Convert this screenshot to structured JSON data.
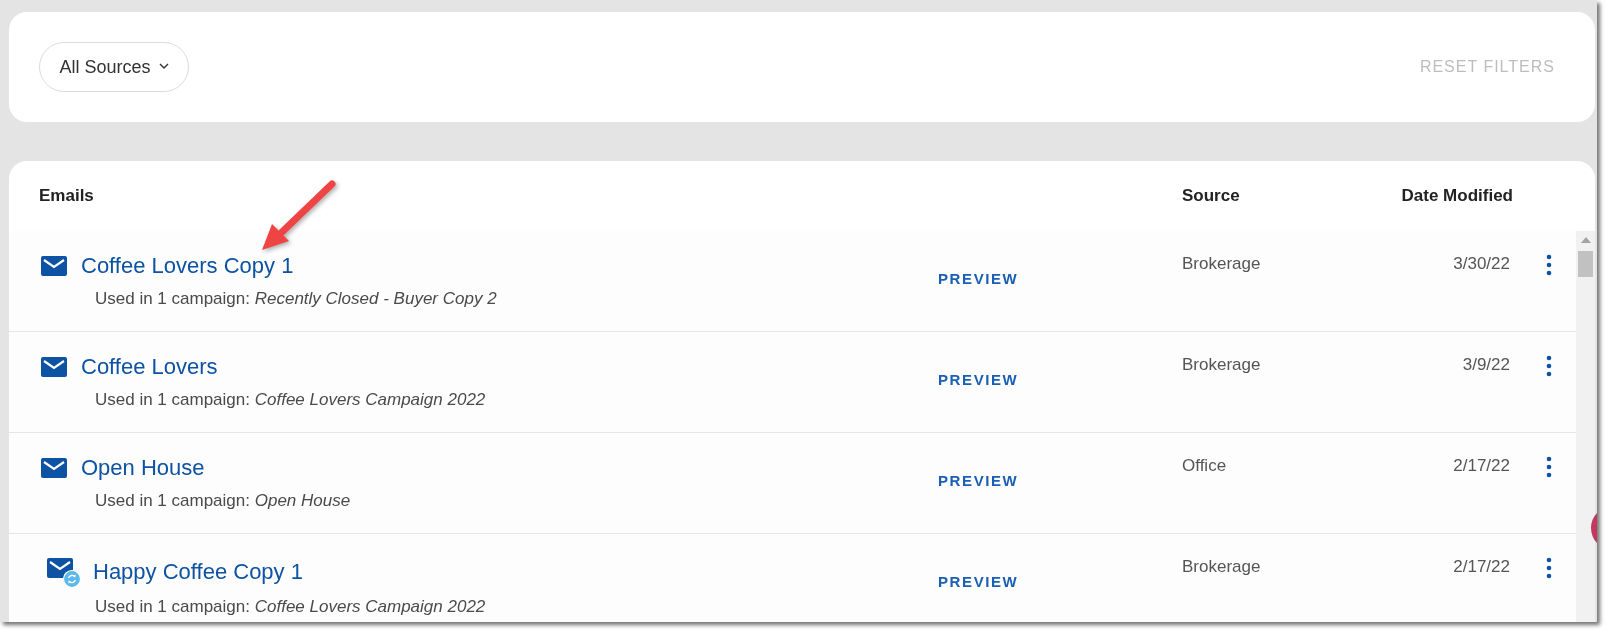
{
  "filters": {
    "source_dropdown": {
      "label": "All Sources"
    },
    "reset_button": {
      "label": "RESET FILTERS",
      "disabled": true
    }
  },
  "table": {
    "columns": [
      "Emails",
      "Source",
      "Date Modified"
    ],
    "rows": [
      {
        "title": "Coffee Lovers Copy 1",
        "usage": "Used in 1 campaign: *Recently Closed - Buyer Copy 2*",
        "preview": "PREVIEW",
        "source": "Brokerage",
        "date": "3/30/22",
        "synced": false
      },
      {
        "title": "Coffee Lovers",
        "usage": "Used in 1 campaign: *Coffee Lovers Campaign 2022*",
        "preview": "PREVIEW",
        "source": "Brokerage",
        "date": "3/9/22",
        "synced": false
      },
      {
        "title": "Open House",
        "usage": "Used in 1 campaign: *Open House*",
        "preview": "PREVIEW",
        "source": "Office",
        "date": "2/17/22",
        "synced": false
      },
      {
        "title": "Happy Coffee Copy 1",
        "usage": "Used in 1 campaign: *Coffee Lovers Campaign 2022*",
        "preview": "PREVIEW",
        "source": "Brokerage",
        "date": "2/17/22",
        "synced": true
      }
    ]
  }
}
